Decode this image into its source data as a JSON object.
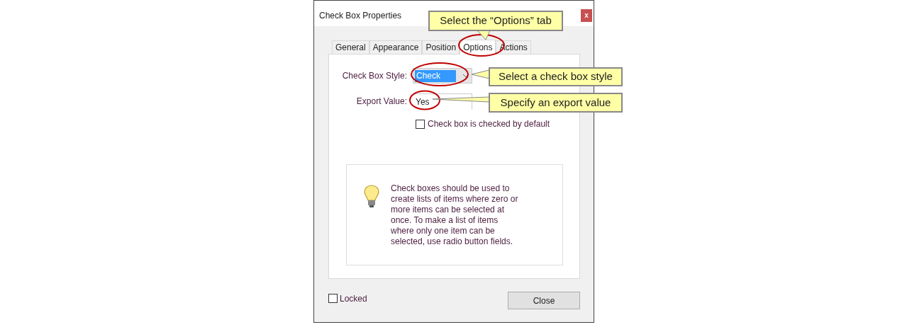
{
  "window": {
    "title": "Check Box Properties",
    "close": "x"
  },
  "tabs": [
    {
      "label": "General",
      "selected": false
    },
    {
      "label": "Appearance",
      "selected": false
    },
    {
      "label": "Position",
      "selected": false
    },
    {
      "label": "Options",
      "selected": true
    },
    {
      "label": "Actions",
      "selected": false
    }
  ],
  "style_field": {
    "label": "Check Box Style:",
    "value": "Check"
  },
  "export_field": {
    "label": "Export Value:",
    "value": "Yes"
  },
  "default_checkbox": {
    "label": "Check box is checked by default",
    "checked": false
  },
  "info": "Check boxes should be used to create lists of items where zero or more items can be selected at once. To make a list of items where only one item can be selected, use radio button fields.",
  "locked_checkbox": {
    "label": "Locked",
    "checked": false
  },
  "close_button": "Close",
  "callouts": [
    {
      "text": "Select the “Options” tab"
    },
    {
      "text": "Select a check box style"
    },
    {
      "text": "Specify an export value"
    }
  ]
}
